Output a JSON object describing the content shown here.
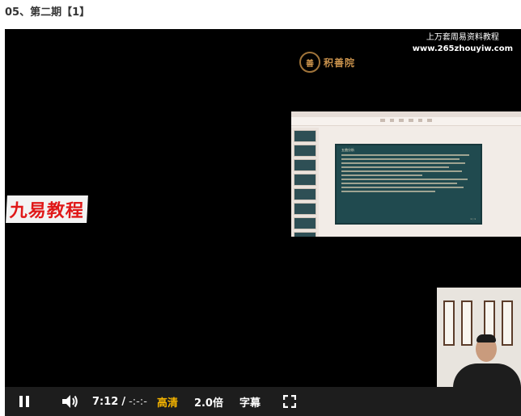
{
  "page": {
    "title": "05、第二期【1】"
  },
  "player": {
    "watermark_line1": "上万套周易资料教程",
    "watermark_line2": "www.265zhouyiw.com",
    "logo_text": "积善院",
    "overlay_label": "九易教程",
    "slide": {
      "heading": "五曲分析",
      "page_indicator": "1 / 1",
      "thumb_count": 8
    },
    "controls": {
      "current_time": "7:12",
      "separator": "/",
      "duration": "-:-:-",
      "quality": "高清",
      "speed": "2.0倍",
      "subtitles": "字幕"
    },
    "icons": [
      "pause-icon",
      "volume-icon",
      "fullscreen-icon"
    ],
    "colors": {
      "quality_accent": "#f5b400",
      "label_red": "#e01818"
    }
  }
}
